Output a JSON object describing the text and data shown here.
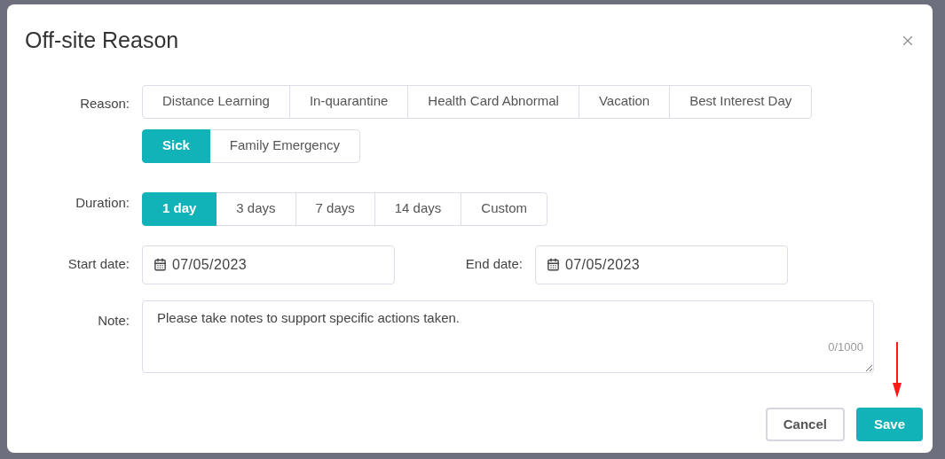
{
  "dialog": {
    "title": "Off-site Reason",
    "reason": {
      "label": "Reason:",
      "rows": [
        [
          {
            "label": "Distance Learning",
            "selected": false
          },
          {
            "label": "In-quarantine",
            "selected": false
          },
          {
            "label": "Health Card Abnormal",
            "selected": false
          },
          {
            "label": "Vacation",
            "selected": false
          },
          {
            "label": "Best Interest Day",
            "selected": false
          }
        ],
        [
          {
            "label": "Sick",
            "selected": true
          },
          {
            "label": "Family Emergency",
            "selected": false
          }
        ]
      ]
    },
    "duration": {
      "label": "Duration:",
      "options": [
        {
          "label": "1 day",
          "selected": true
        },
        {
          "label": "3 days",
          "selected": false
        },
        {
          "label": "7 days",
          "selected": false
        },
        {
          "label": "14 days",
          "selected": false
        },
        {
          "label": "Custom",
          "selected": false
        }
      ]
    },
    "start_date": {
      "label": "Start date:",
      "value": "07/05/2023"
    },
    "end_date": {
      "label": "End date:",
      "value": "07/05/2023"
    },
    "note": {
      "label": "Note:",
      "placeholder": "Please take notes to support specific actions taken.",
      "counter": "0/1000"
    },
    "buttons": [
      {
        "label": "Cancel",
        "kind": "secondary"
      },
      {
        "label": "Save",
        "kind": "primary"
      }
    ]
  }
}
